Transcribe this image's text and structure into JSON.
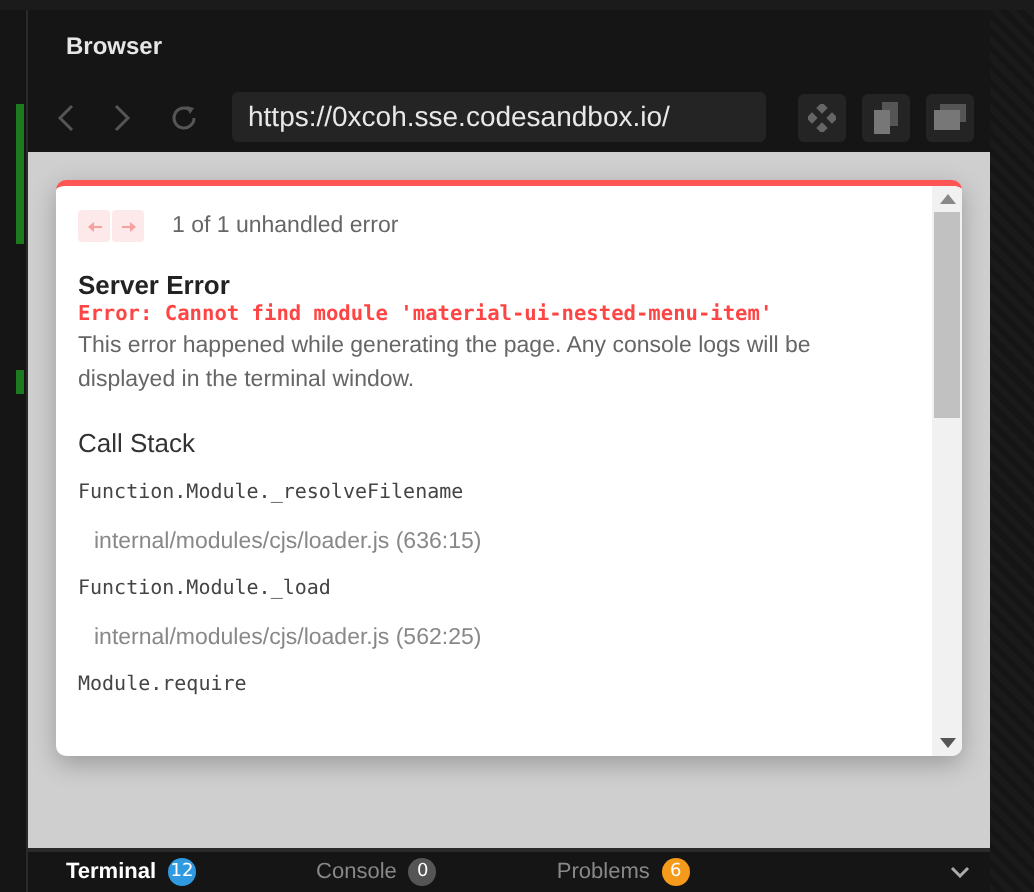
{
  "browser": {
    "title": "Browser",
    "url": "https://0xcoh.sse.codesandbox.io/"
  },
  "error_overlay": {
    "pager": "1 of 1 unhandled error",
    "title": "Server Error",
    "message": "Error: Cannot find module 'material-ui-nested-menu-item'",
    "description": "This error happened while generating the page. Any console logs will be displayed in the terminal window.",
    "stack_title": "Call Stack",
    "frames": [
      {
        "function": "Function.Module._resolveFilename",
        "location": "internal/modules/cjs/loader.js (636:15)"
      },
      {
        "function": "Function.Module._load",
        "location": "internal/modules/cjs/loader.js (562:25)"
      },
      {
        "function": "Module.require"
      }
    ]
  },
  "bottom_tabs": [
    {
      "label": "Terminal",
      "badge": "12",
      "color": "#2f9ae0",
      "selected": true
    },
    {
      "label": "Console",
      "badge": "0",
      "color": "#555555",
      "selected": false
    },
    {
      "label": "Problems",
      "badge": "6",
      "color": "#f59a1b",
      "selected": false
    }
  ]
}
